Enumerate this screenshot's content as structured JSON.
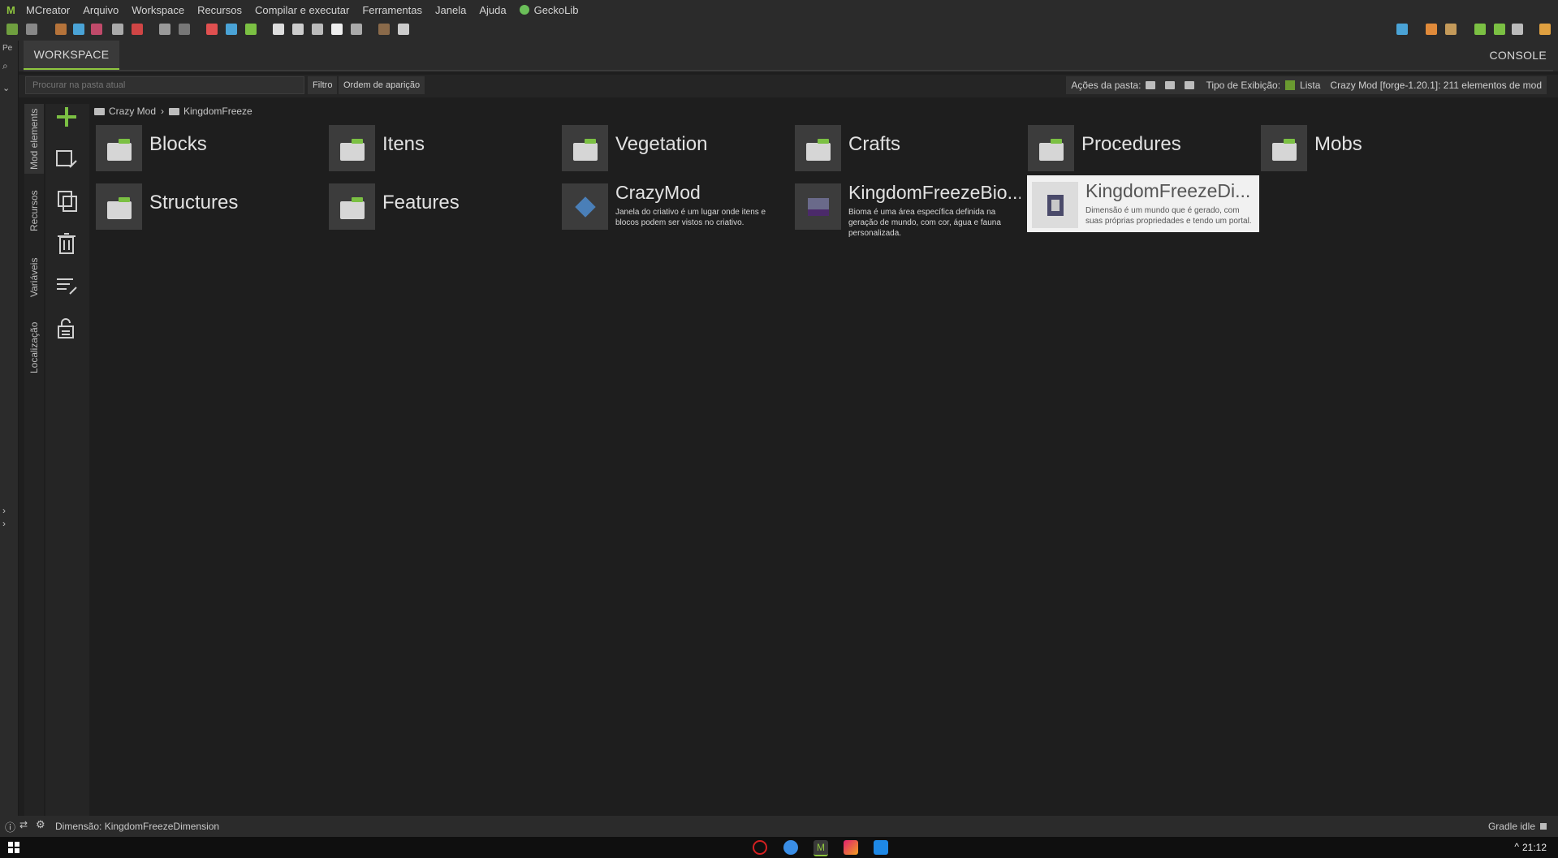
{
  "menu": {
    "items": [
      "MCreator",
      "Arquivo",
      "Workspace",
      "Recursos",
      "Compilar e executar",
      "Ferramentas",
      "Janela",
      "Ajuda",
      "GeckoLib"
    ]
  },
  "tabs": {
    "workspace": "WORKSPACE",
    "console": "CONSOLE"
  },
  "left_strip": {
    "label": "Pe"
  },
  "searchbar": {
    "placeholder": "Procurar na pasta atual",
    "filter": "Filtro",
    "order": "Ordem de aparição",
    "folder_actions": "Ações da pasta:",
    "view_type": "Tipo de Exibição:",
    "view_mode": "Lista",
    "workspace_info": "Crazy Mod [forge-1.20.1]: 211 elementos de mod"
  },
  "vertical_tabs": [
    "Mod elements",
    "Recursos",
    "Variáveis",
    "Localização"
  ],
  "breadcrumb": {
    "root": "Crazy Mod",
    "current": "KingdomFreeze"
  },
  "folders": [
    {
      "name": "Blocks"
    },
    {
      "name": "Itens"
    },
    {
      "name": "Vegetation"
    },
    {
      "name": "Crafts"
    },
    {
      "name": "Procedures"
    },
    {
      "name": "Mobs"
    },
    {
      "name": "Structures"
    },
    {
      "name": "Features"
    }
  ],
  "elements": [
    {
      "name": "CrazyMod",
      "description": "Janela do criativo é um lugar onde itens e blocos podem ser vistos no criativo.",
      "selected": false
    },
    {
      "name": "KingdomFreezeBio...",
      "description": "Bioma é uma área específica definida na geração de mundo, com cor, água e fauna personalizada.",
      "selected": false
    },
    {
      "name": "KingdomFreezeDi...",
      "description": "Dimensão é um mundo que é gerado, com suas próprias propriedades e tendo um portal.",
      "selected": true
    }
  ],
  "status": {
    "text": "Dimensão: KingdomFreezeDimension",
    "gradle": "Gradle idle"
  },
  "taskbar": {
    "clock": "21:12"
  },
  "colors": {
    "accent": "#8fc63f",
    "background": "#1e1e1e",
    "panel": "#2b2b2b"
  }
}
